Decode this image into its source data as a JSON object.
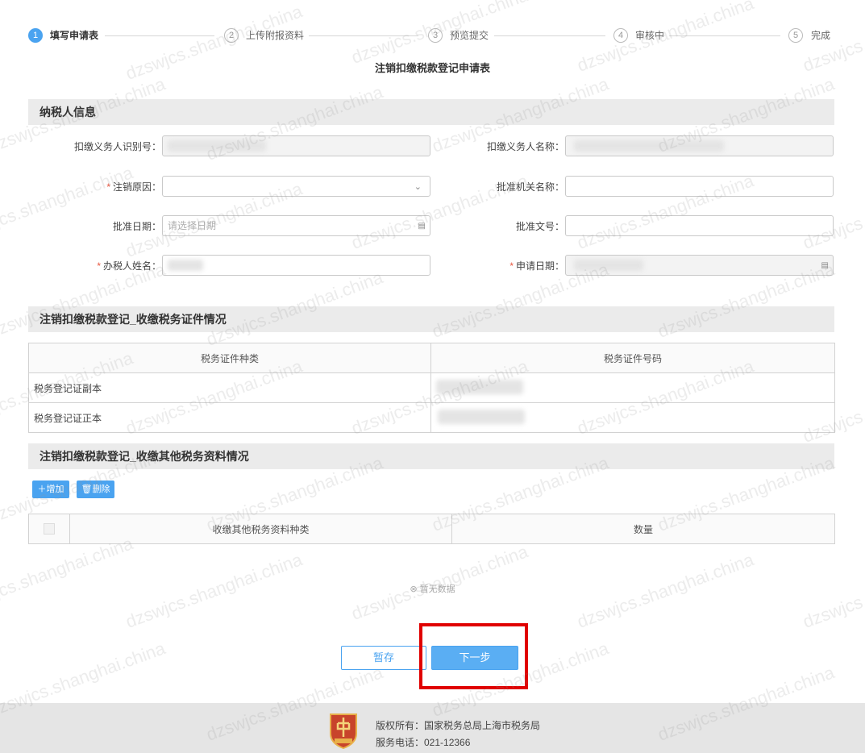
{
  "steps": [
    {
      "num": "1",
      "label": "填写申请表",
      "state": "active"
    },
    {
      "num": "2",
      "label": "上传附报资料",
      "state": "todo"
    },
    {
      "num": "3",
      "label": "预览提交",
      "state": "todo"
    },
    {
      "num": "4",
      "label": "审核中",
      "state": "todo"
    },
    {
      "num": "5",
      "label": "完成",
      "state": "todo"
    }
  ],
  "form_title": "注销扣缴税款登记申请表",
  "sections": {
    "taxpayer": "纳税人信息",
    "certificates": "注销扣缴税款登记_收缴税务证件情况",
    "other_docs": "注销扣缴税款登记_收缴其他税务资料情况"
  },
  "fields": {
    "withholder_id_label": "扣缴义务人识别号：",
    "withholder_name_label": "扣缴义务人名称：",
    "cancel_reason_label": "注销原因：",
    "approval_org_label": "批准机关名称：",
    "approval_date_label": "批准日期：",
    "approval_date_placeholder": "请选择日期",
    "approval_doc_label": "批准文号：",
    "handler_name_label": "办税人姓名：",
    "apply_date_label": "申请日期：",
    "required_mark": "*"
  },
  "cert_table": {
    "headers": [
      "税务证件种类",
      "税务证件号码"
    ],
    "rows": [
      {
        "type": "税务登记证副本"
      },
      {
        "type": "税务登记证正本"
      }
    ]
  },
  "other_docs_table": {
    "add_label": "增加",
    "delete_label": "删除",
    "headers": [
      "收缴其他税务资料种类",
      "数量"
    ],
    "empty_text": "暂无数据"
  },
  "buttons": {
    "save": "暂存",
    "next": "下一步"
  },
  "footer": {
    "copyright": "版权所有：国家税务总局上海市税务局",
    "phone": "服务电话：021-12366"
  },
  "watermark": "dzswjcs.shanghai.china",
  "colors": {
    "accent": "#4aa3f0",
    "highlight": "#e00000",
    "section_bg": "#ebebeb",
    "footer_bg": "#e5e5e5"
  }
}
